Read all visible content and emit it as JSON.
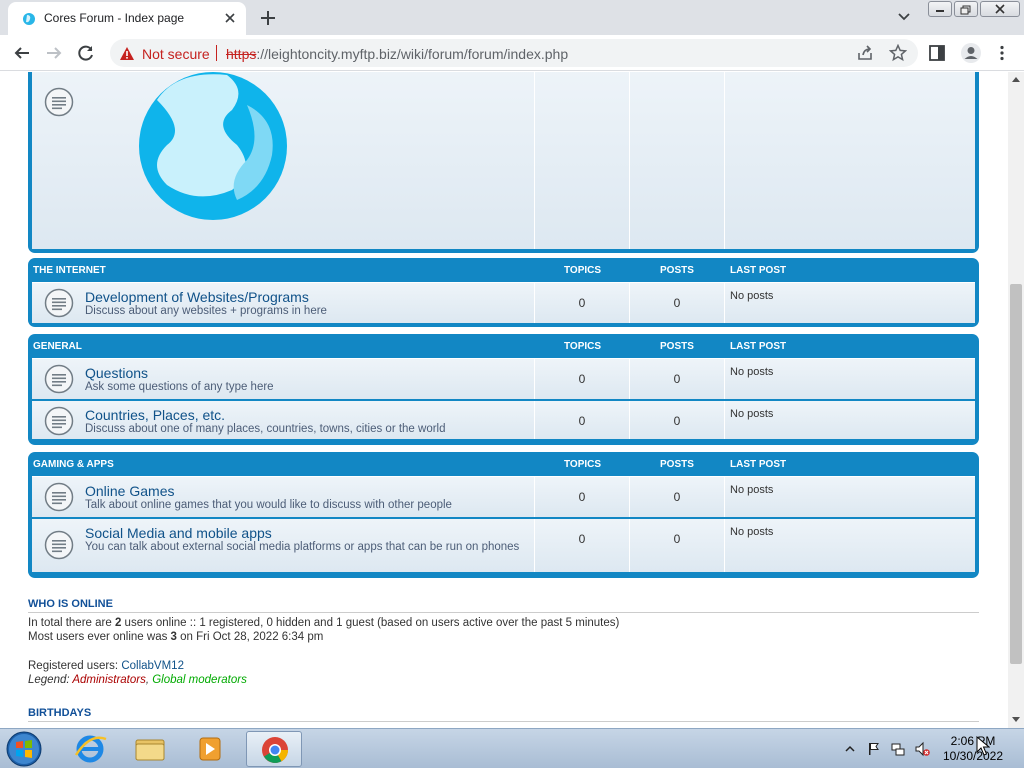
{
  "browser": {
    "tab_title": "Cores Forum - Index page",
    "security_label": "Not secure",
    "url_scheme": "https",
    "url_rest": "://leightoncity.myftp.biz/wiki/forum/forum/index.php"
  },
  "categories": [
    {
      "name": "THE INTERNET",
      "topics_header": "TOPICS",
      "posts_header": "POSTS",
      "last_post_header": "LAST POST",
      "forums": [
        {
          "title": "Development of Websites/Programs",
          "description": "Discuss about any websites + programs in here",
          "topics": "0",
          "posts": "0",
          "last_post": "No posts"
        }
      ]
    },
    {
      "name": "GENERAL",
      "topics_header": "TOPICS",
      "posts_header": "POSTS",
      "last_post_header": "LAST POST",
      "forums": [
        {
          "title": "Questions",
          "description": "Ask some questions of any type here",
          "topics": "0",
          "posts": "0",
          "last_post": "No posts"
        },
        {
          "title": "Countries, Places, etc.",
          "description": "Discuss about one of many places, countries, towns, cities or the world",
          "topics": "0",
          "posts": "0",
          "last_post": "No posts"
        }
      ]
    },
    {
      "name": "GAMING & APPS",
      "topics_header": "TOPICS",
      "posts_header": "POSTS",
      "last_post_header": "LAST POST",
      "forums": [
        {
          "title": "Online Games",
          "description": "Talk about online games that you would like to discuss with other people",
          "topics": "0",
          "posts": "0",
          "last_post": "No posts"
        },
        {
          "title": "Social Media and mobile apps",
          "description": "You can talk about external social media platforms or apps that can be run on phones",
          "topics": "0",
          "posts": "0",
          "last_post": "No posts"
        }
      ]
    }
  ],
  "who_is_online": {
    "heading": "WHO IS ONLINE",
    "line1_prefix": "In total there are ",
    "line1_count": "2",
    "line1_suffix": " users online :: 1 registered, 0 hidden and 1 guest (based on users active over the past 5 minutes)",
    "line2_prefix": "Most users ever online was ",
    "line2_count": "3",
    "line2_suffix": " on Fri Oct 28, 2022 6:34 pm",
    "registered_label": "Registered users: ",
    "registered_user": "CollabVM12",
    "legend_label": "Legend: ",
    "legend_admins": "Administrators",
    "legend_sep": ", ",
    "legend_globmods": "Global moderators"
  },
  "birthdays": {
    "heading": "BIRTHDAYS"
  },
  "taskbar": {
    "time": "2:06 PM",
    "date": "10/30/2022"
  },
  "colors": {
    "category_blue": "#1287c4",
    "forum_title": "#105289",
    "not_secure_red": "#c5221f"
  }
}
